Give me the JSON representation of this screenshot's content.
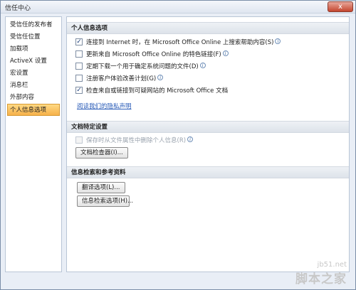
{
  "window": {
    "title": "信任中心",
    "close_label": "x"
  },
  "sidebar": {
    "items": [
      {
        "label": "受信任的发布者"
      },
      {
        "label": "受信任位置"
      },
      {
        "label": "加载项"
      },
      {
        "label": "ActiveX 设置"
      },
      {
        "label": "宏设置"
      },
      {
        "label": "消息栏"
      },
      {
        "label": "外部内容"
      },
      {
        "label": "个人信息选项",
        "active": true
      }
    ]
  },
  "privacy": {
    "header": "个人信息选项",
    "options": [
      {
        "label": "连接到 Internet 时，在 Microsoft Office Online 上搜索帮助内容(S)",
        "checked": true
      },
      {
        "label": "更新来自 Microsoft Office Online 的特色链接(F)",
        "checked": false
      },
      {
        "label": "定期下载一个用于确定系统问题的文件(D)",
        "checked": false
      },
      {
        "label": "注册客户体验改善计划(G)",
        "checked": false
      },
      {
        "label": "检查来自或链接到可疑网站的 Microsoft Office 文档",
        "checked": true
      }
    ],
    "privacy_link": "阅读我们的隐私声明"
  },
  "document": {
    "header": "文档特定设置",
    "remove_info_label": "保存时从文件属性中删除个人信息(R)",
    "inspector_button": "文档检查器(I)..."
  },
  "research": {
    "header": "信息检索和参考资料",
    "translate_button": "翻译选项(L)...",
    "research_button": "信息检索选项(H)..."
  },
  "watermark": {
    "url": "jb51.net",
    "text": "脚本之家"
  },
  "icons": {
    "info": "info-icon",
    "check": "checkmark-icon"
  }
}
